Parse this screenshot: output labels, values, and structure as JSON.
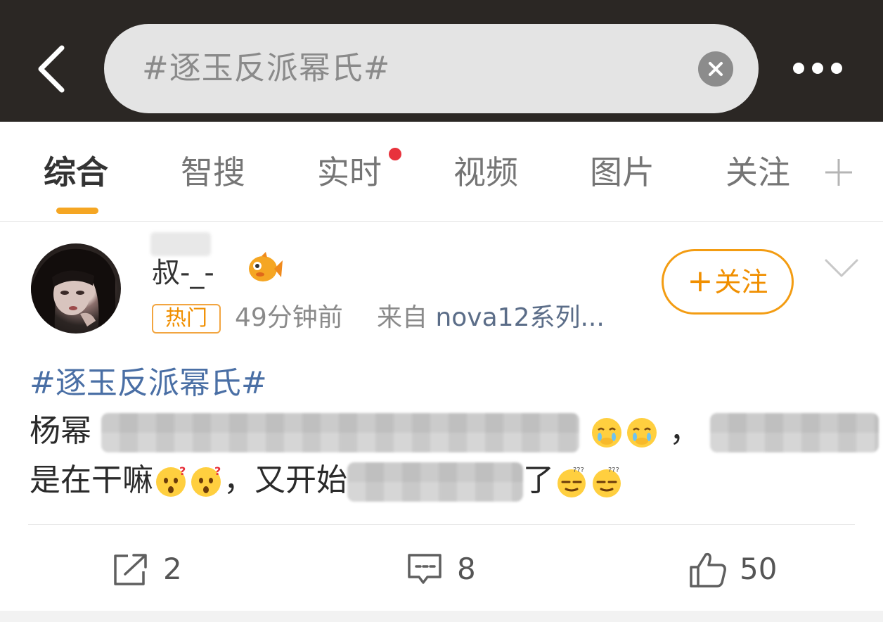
{
  "header": {
    "search_text": "#逐玉反派幂氏#",
    "back_icon": "chevron-left-icon",
    "clear_icon": "close-circle-icon",
    "more_icon": "more-dots-icon"
  },
  "tabs": [
    {
      "label": "综合",
      "active": true
    },
    {
      "label": "智搜",
      "active": false
    },
    {
      "label": "实时",
      "active": false,
      "has_red_dot": true
    },
    {
      "label": "视频",
      "active": false
    },
    {
      "label": "图片",
      "active": false
    },
    {
      "label": "关注",
      "active": false
    }
  ],
  "add_tab_icon": "plus-icon",
  "post": {
    "username": "叔-_-",
    "badge_icon": "fish-icon",
    "hot_label": "热门",
    "time": "49分钟前",
    "from_label": "来自",
    "device": "nova12系列...",
    "follow_label": "关注",
    "topic": "#逐玉反派幂氏#",
    "line1_start": "杨幂",
    "line1_comma": "，",
    "line2_start": "是在干嘛",
    "line2_mid": "，又开始",
    "line2_end": "了",
    "actions": {
      "repost_count": "2",
      "comment_count": "8",
      "like_count": "50"
    }
  },
  "colors": {
    "accent": "#f39c12",
    "topic_link": "#4a6fa5",
    "header_bg": "#2b2724"
  }
}
